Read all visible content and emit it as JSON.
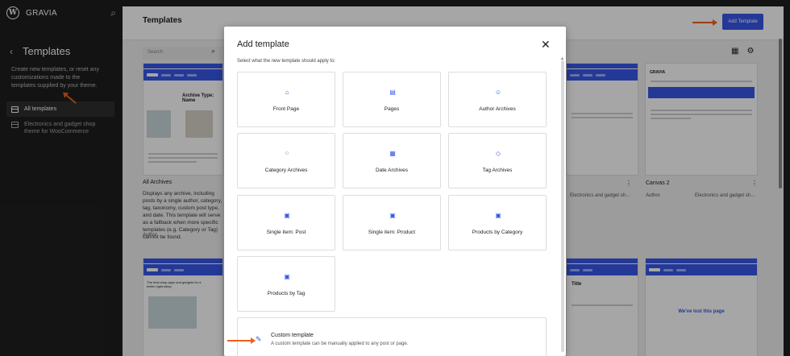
{
  "site": {
    "name": "GRAVIA"
  },
  "sidebar": {
    "title": "Templates",
    "description": "Create new templates, or reset any customizations made to the templates supplied by your theme.",
    "items": [
      {
        "label": "All templates"
      },
      {
        "label": "Electronics and gadget shop theme for WooCommerce"
      }
    ]
  },
  "header": {
    "title": "Templates",
    "add_button": "Add Template"
  },
  "search": {
    "placeholder": "Search"
  },
  "cards": {
    "all_archives": {
      "preview_heading": "Archive Type: Name",
      "title": "All Archives",
      "description": "Displays any archive, including posts by a single author, category, tag, taxonomy, custom post type, and date. This template will serve as a fallback when more specific templates (e.g. Category or Tag) cannot be found.",
      "author": "Author",
      "theme": "Electronics and gadget sh…"
    },
    "middle_right": {
      "author": "Author",
      "theme": "Electronics and gadget sh…"
    },
    "canvas2": {
      "title": "Canvas 2",
      "author": "Author",
      "theme": "Electronics and gadget sh…"
    },
    "bottom_left": {
      "headline": "The best shop apps and gadgets for a better night sleep"
    },
    "bottom_mid": {
      "heading": "Title"
    },
    "bottom_right": {
      "heading": "We've lost this page"
    }
  },
  "modal": {
    "title": "Add template",
    "subtitle": "Select what the new template should apply to:",
    "tiles": [
      {
        "label": "Front Page",
        "icon": "home-icon"
      },
      {
        "label": "Pages",
        "icon": "page-icon"
      },
      {
        "label": "Author Archives",
        "icon": "author-icon"
      },
      {
        "label": "Category Archives",
        "icon": "category-icon"
      },
      {
        "label": "Date Archives",
        "icon": "calendar-icon"
      },
      {
        "label": "Tag Archives",
        "icon": "tag-icon"
      },
      {
        "label": "Single item: Post",
        "icon": "layout-icon"
      },
      {
        "label": "Single item: Product",
        "icon": "layout-icon"
      },
      {
        "label": "Products by Category",
        "icon": "layout-icon"
      },
      {
        "label": "Products by Tag",
        "icon": "layout-icon"
      }
    ],
    "custom": {
      "title": "Custom template",
      "description": "A custom template can be manually applied to any post or page."
    }
  },
  "colors": {
    "accent": "#3858e9",
    "annotation": "#f06018"
  }
}
